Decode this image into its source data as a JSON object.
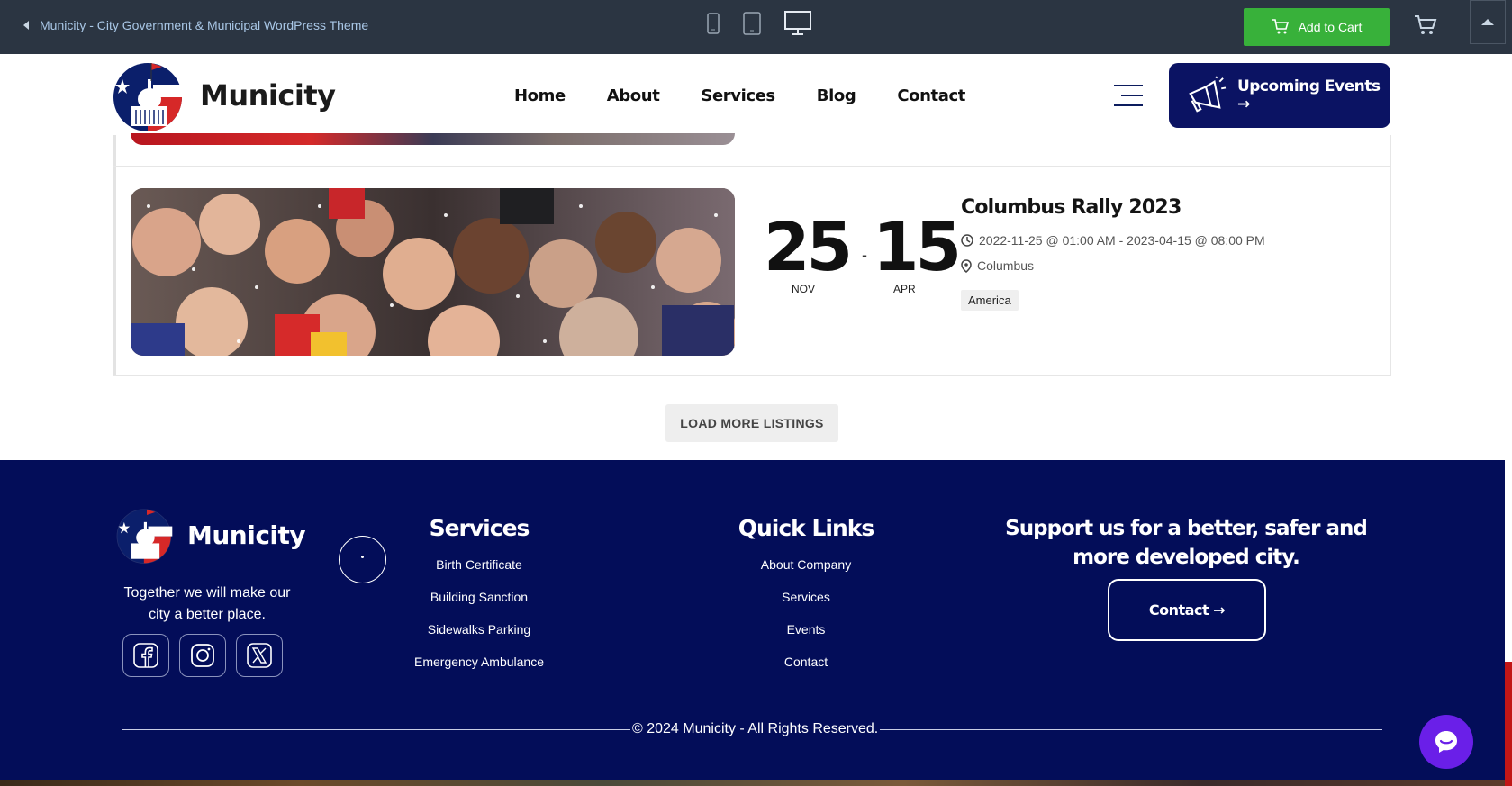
{
  "preview_bar": {
    "back_label": "Municity - City Government & Municipal WordPress Theme",
    "devices": [
      "mobile-icon",
      "tablet-icon",
      "desktop-icon"
    ],
    "add_to_cart_label": "Add to Cart"
  },
  "header": {
    "logo_text": "Municity",
    "nav": [
      "Home",
      "About",
      "Services",
      "Blog",
      "Contact"
    ],
    "upcoming_label": "Upcoming Events →"
  },
  "event": {
    "start_day": "25",
    "start_month": "NOV",
    "end_day": "15",
    "end_month": "APR",
    "dash": "-",
    "title": "Columbus Rally 2023",
    "datetime": "2022-11-25 @ 01:00 AM - 2023-04-15 @ 08:00 PM",
    "location": "Columbus",
    "category": "America"
  },
  "load_more_label": "LOAD MORE LISTINGS",
  "footer": {
    "logo_text": "Municity",
    "tagline": "Together we will make our city a better place.",
    "services_title": "Services",
    "services": [
      "Birth Certificate",
      "Building Sanction",
      "Sidewalks Parking",
      "Emergency Ambulance"
    ],
    "quick_title": "Quick Links",
    "quick_links": [
      "About Company",
      "Services",
      "Events",
      "Contact"
    ],
    "support_text": "Support us for a better, safer and more developed city.",
    "contact_label": "Contact →",
    "copyright": "© 2024 Municity - All Rights Reserved."
  },
  "colors": {
    "preview_bar": "#2b3542",
    "cart_green": "#38b13a",
    "navy": "#030d59",
    "button_navy": "#0b1363",
    "chat_purple": "#6a1fe8"
  }
}
